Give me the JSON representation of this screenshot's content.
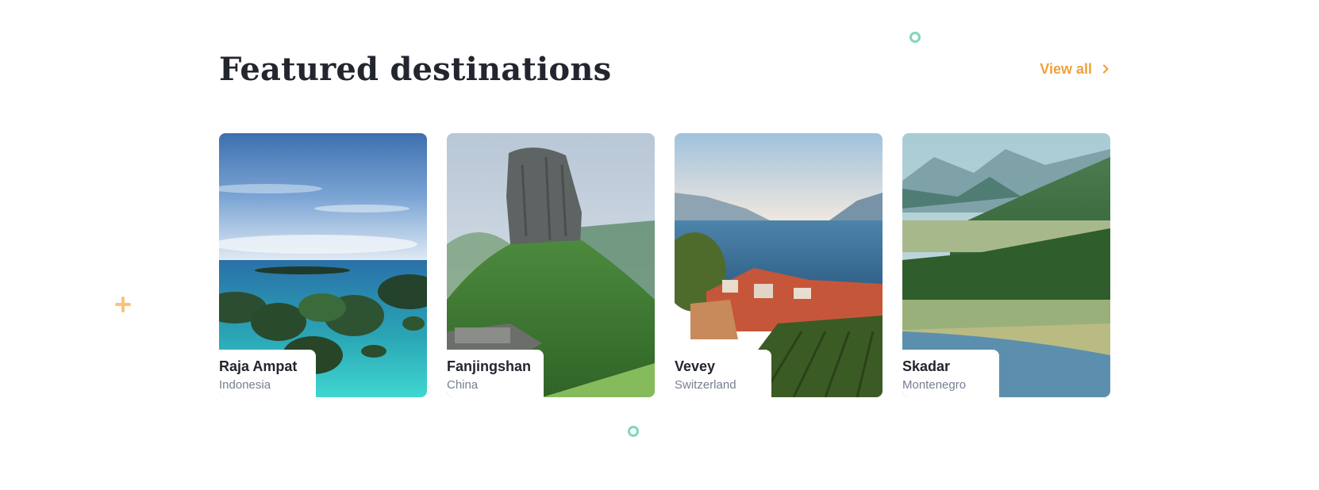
{
  "section": {
    "title": "Featured destinations",
    "view_all_label": "View all",
    "accent_color": "#f0a13a"
  },
  "destinations": [
    {
      "name": "Raja Ampat",
      "country": "Indonesia"
    },
    {
      "name": "Fanjingshan",
      "country": "China"
    },
    {
      "name": "Vevey",
      "country": "Switzerland"
    },
    {
      "name": "Skadar",
      "country": "Montenegro"
    }
  ],
  "icons": {
    "view_all": "chevron-right-icon",
    "decorations": [
      "ring-icon",
      "plus-icon",
      "ring-icon"
    ]
  }
}
